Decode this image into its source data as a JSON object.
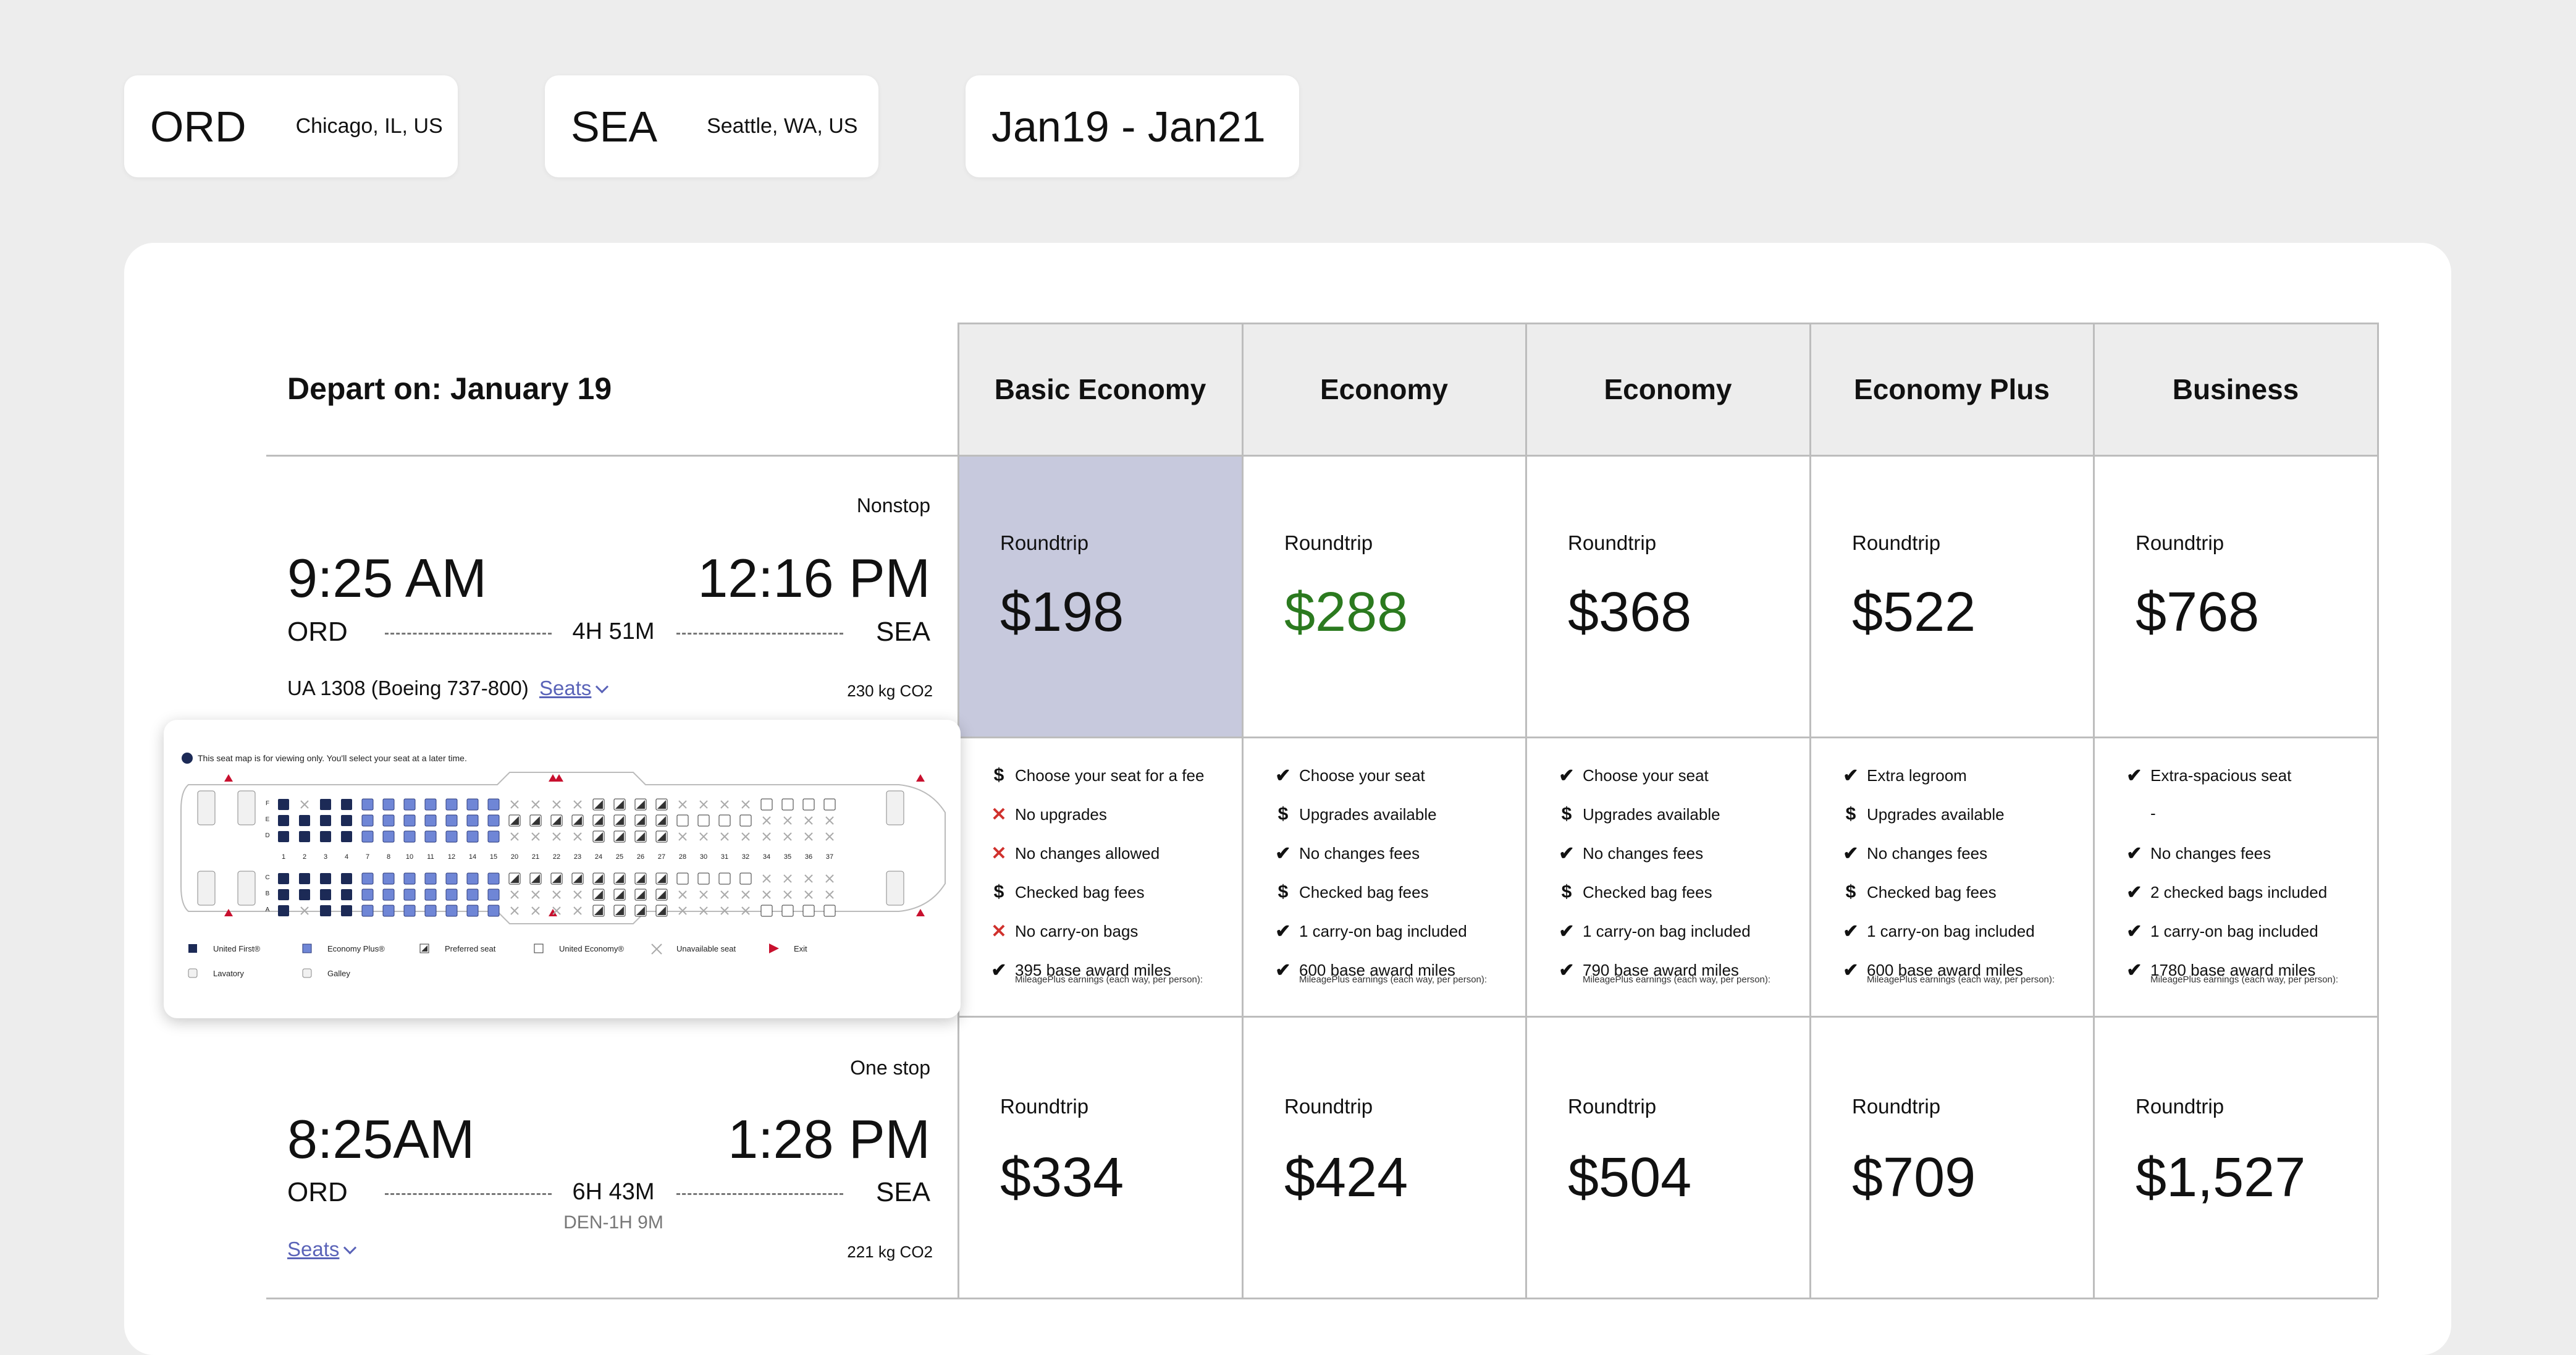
{
  "search": {
    "origin": {
      "code": "ORD",
      "city": "Chicago, IL, US"
    },
    "destination": {
      "code": "SEA",
      "city": "Seattle, WA, US"
    },
    "dates": "Jan19 - Jan21"
  },
  "table": {
    "depart_label": "Depart on:  January 19",
    "fare_classes": [
      "Basic Economy",
      "Economy",
      "Economy",
      "Economy Plus",
      "Business"
    ],
    "selected_fare_index": 0,
    "colors": {
      "selected_bg": "#c7c9dd",
      "highlight_price": "#2b7a1f",
      "header_bg": "#ededed"
    }
  },
  "flights": [
    {
      "stops": "Nonstop",
      "depart_time": "9:25 AM",
      "arrive_time": "12:16 PM",
      "from": "ORD",
      "to": "SEA",
      "duration": "4H 51M",
      "layover": "",
      "aircraft": "UA 1308 (Boeing 737-800)",
      "seats_label": "Seats",
      "co2": "230 kg CO2",
      "roundtrip_label": "Roundtrip",
      "prices": [
        "$198",
        "$288",
        "$368",
        "$522",
        "$768"
      ],
      "price_highlight_index": 1,
      "features": [
        [
          {
            "icon": "dollar",
            "text": "Choose your seat for a fee"
          },
          {
            "icon": "cross",
            "text": "No upgrades"
          },
          {
            "icon": "cross",
            "text": "No changes allowed"
          },
          {
            "icon": "dollar",
            "text": "Checked bag fees"
          },
          {
            "icon": "cross",
            "text": "No carry-on bags"
          },
          {
            "icon": "check",
            "text": "395 base award miles"
          }
        ],
        [
          {
            "icon": "check",
            "text": "Choose your seat"
          },
          {
            "icon": "dollar",
            "text": "Upgrades available"
          },
          {
            "icon": "check",
            "text": "No changes fees"
          },
          {
            "icon": "dollar",
            "text": "Checked bag fees"
          },
          {
            "icon": "check",
            "text": "1 carry-on bag included"
          },
          {
            "icon": "check",
            "text": "600 base award miles"
          }
        ],
        [
          {
            "icon": "check",
            "text": "Choose your seat"
          },
          {
            "icon": "dollar",
            "text": "Upgrades available"
          },
          {
            "icon": "check",
            "text": "No changes fees"
          },
          {
            "icon": "dollar",
            "text": "Checked bag fees"
          },
          {
            "icon": "check",
            "text": "1 carry-on bag included"
          },
          {
            "icon": "check",
            "text": "790 base award miles"
          }
        ],
        [
          {
            "icon": "check",
            "text": "Extra legroom"
          },
          {
            "icon": "dollar",
            "text": "Upgrades available"
          },
          {
            "icon": "check",
            "text": "No changes fees"
          },
          {
            "icon": "dollar",
            "text": "Checked bag fees"
          },
          {
            "icon": "check",
            "text": "1 carry-on bag included"
          },
          {
            "icon": "check",
            "text": "600 base award miles"
          }
        ],
        [
          {
            "icon": "check",
            "text": "Extra-spacious seat"
          },
          {
            "icon": "none",
            "text": "-"
          },
          {
            "icon": "check",
            "text": "No changes fees"
          },
          {
            "icon": "check",
            "text": "2 checked bags included"
          },
          {
            "icon": "check",
            "text": "1 carry-on bag included"
          },
          {
            "icon": "check",
            "text": "1780 base award miles"
          }
        ]
      ],
      "miles_note": "MileagePlus earnings (each way, per person):"
    },
    {
      "stops": "One stop",
      "depart_time": "8:25AM",
      "arrive_time": "1:28 PM",
      "from": "ORD",
      "to": "SEA",
      "duration": "6H 43M",
      "layover": "DEN-1H 9M",
      "aircraft": "",
      "seats_label": "Seats",
      "co2": "221 kg CO2",
      "roundtrip_label": "Roundtrip",
      "prices": [
        "$334",
        "$424",
        "$504",
        "$709",
        "$1,527"
      ],
      "price_highlight_index": -1
    }
  ],
  "seat_map": {
    "notice": "This seat map is for viewing only. You'll select your seat at a later time.",
    "row_numbers": [
      "1",
      "2",
      "3",
      "4",
      "7",
      "8",
      "10",
      "11",
      "12",
      "14",
      "15",
      "20",
      "21",
      "22",
      "23",
      "24",
      "25",
      "26",
      "27",
      "28",
      "30",
      "31",
      "32",
      "34",
      "35",
      "36",
      "37"
    ],
    "letters_upper": [
      "F",
      "E",
      "D"
    ],
    "letters_lower": [
      "C",
      "B",
      "A"
    ],
    "legend": [
      {
        "kind": "first",
        "label": "United First®"
      },
      {
        "kind": "plus",
        "label": "Economy Plus®"
      },
      {
        "kind": "preferred",
        "label": "Preferred seat"
      },
      {
        "kind": "economy",
        "label": "United Economy®"
      },
      {
        "kind": "unavailable",
        "label": "Unavailable seat"
      },
      {
        "kind": "exit",
        "label": "Exit"
      },
      {
        "kind": "lavatory",
        "label": "Lavatory"
      },
      {
        "kind": "galley",
        "label": "Galley"
      }
    ]
  }
}
